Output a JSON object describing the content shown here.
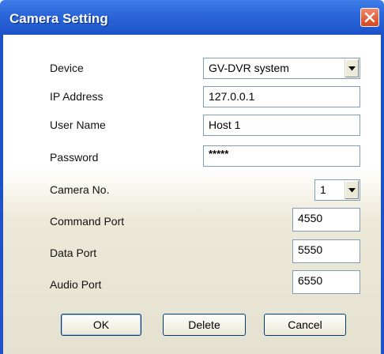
{
  "window": {
    "title": "Camera Setting"
  },
  "icons": {
    "close": "close-icon",
    "dropdown": "chevron-down-icon"
  },
  "form": {
    "device": {
      "label": "Device",
      "value": "GV-DVR system"
    },
    "ip_address": {
      "label": "IP Address",
      "value": "127.0.0.1"
    },
    "user_name": {
      "label": "User Name",
      "value": "Host 1"
    },
    "password": {
      "label": "Password",
      "value": "*****"
    },
    "camera_no": {
      "label": "Camera No.",
      "value": "1"
    },
    "command_port": {
      "label": "Command Port",
      "value": "4550"
    },
    "data_port": {
      "label": "Data Port",
      "value": "5550"
    },
    "audio_port": {
      "label": "Audio Port",
      "value": "6550"
    }
  },
  "buttons": {
    "ok": "OK",
    "delete": "Delete",
    "cancel": "Cancel"
  },
  "colors": {
    "title_bar": "#2a65d9",
    "close_button": "#d6451f",
    "field_border": "#7f9db9"
  }
}
